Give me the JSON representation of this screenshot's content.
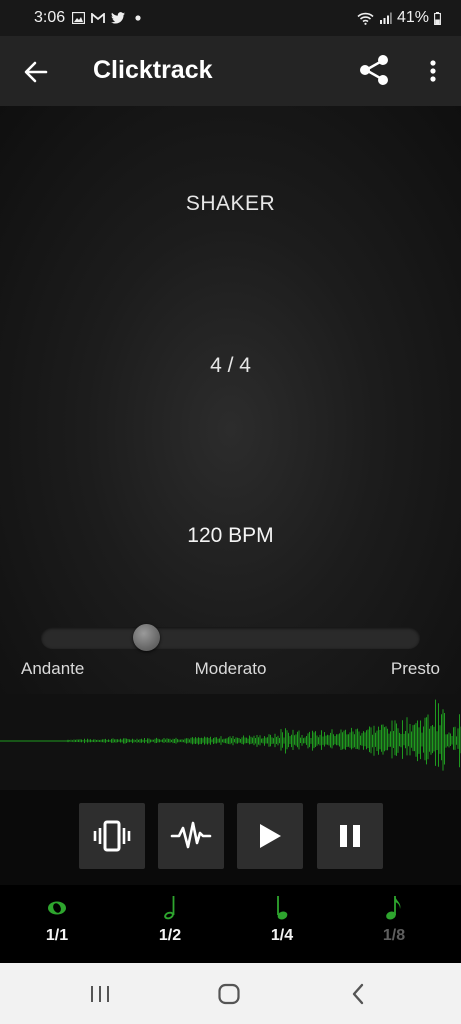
{
  "status_bar": {
    "time": "3:06",
    "battery": "41%",
    "icons": [
      "image-icon",
      "gmail-icon",
      "twitter-icon",
      "dot-icon",
      "wifi-icon",
      "signal-icon",
      "battery-icon"
    ]
  },
  "app_bar": {
    "title": "Clicktrack",
    "icons": [
      "back-arrow-icon",
      "share-icon",
      "more-vert-icon"
    ]
  },
  "main": {
    "sound_name": "SHAKER",
    "time_signature": "4 / 4",
    "bpm_label": "120 BPM",
    "tempo_slider": {
      "position_fraction": 0.27,
      "labels": [
        "Andante",
        "Moderato",
        "Presto"
      ]
    }
  },
  "controls": {
    "buttons": [
      "vibrate-icon",
      "waveform-icon",
      "play-icon",
      "pause-icon"
    ]
  },
  "note_values": [
    {
      "label": "1/1",
      "icon": "whole-note-icon",
      "active": true
    },
    {
      "label": "1/2",
      "icon": "half-note-icon",
      "active": true
    },
    {
      "label": "1/4",
      "icon": "quarter-note-icon",
      "active": true
    },
    {
      "label": "1/8",
      "icon": "eighth-note-icon",
      "active": false
    }
  ],
  "nav_bar": {
    "icons": [
      "recent-apps-icon",
      "home-icon",
      "back-icon"
    ]
  },
  "colors": {
    "accent_green": "#2ea52e",
    "waveform_green": "#1f9a1f",
    "app_bar": "#242424",
    "nav_bar": "#f2f2f2"
  }
}
